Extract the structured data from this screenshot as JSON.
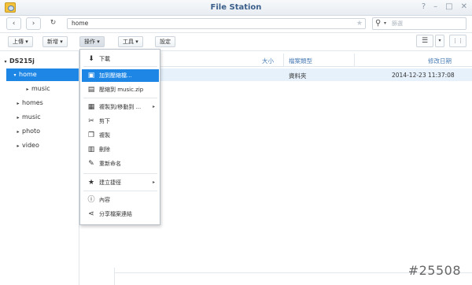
{
  "window": {
    "title": "File Station",
    "controls": [
      "?",
      "–",
      "□",
      "✕"
    ]
  },
  "navigation": {
    "back": "‹",
    "forward": "›",
    "refresh": "↻",
    "path": "home",
    "star": "★",
    "search_placeholder": "篩選"
  },
  "toolbar": {
    "upload": "上傳 ▾",
    "create": "新增 ▾",
    "action": "操作 ▾",
    "tools": "工具 ▾",
    "settings": "設定",
    "view_list": "☰",
    "view_caret": "▾",
    "view_cols": "⋮⋮"
  },
  "tree": {
    "root": "DS215j",
    "items": [
      {
        "label": "home",
        "expanded": true,
        "selected": true
      },
      {
        "label": "music",
        "child": true
      },
      {
        "label": "homes"
      },
      {
        "label": "music"
      },
      {
        "label": "photo"
      },
      {
        "label": "video"
      }
    ]
  },
  "file_list": {
    "columns": {
      "size": "大小",
      "type": "檔案類型",
      "modified": "修改日期"
    },
    "rows": [
      {
        "type": "資料夾",
        "modified": "2014-12-23 11:37:08"
      }
    ]
  },
  "context_menu": {
    "items": [
      {
        "label": "下載",
        "icon": "download-icon",
        "glyph": "⬇"
      },
      {
        "label": "加到壓縮檔...",
        "icon": "archive-icon",
        "glyph": "▣",
        "highlighted": true
      },
      {
        "label": "壓縮到 music.zip",
        "icon": "zip-icon",
        "glyph": "▤"
      },
      {
        "label": "複製到/移動到 ...",
        "icon": "copy-move-icon",
        "glyph": "▦",
        "submenu": "▸"
      },
      {
        "label": "剪下",
        "icon": "scissors-icon",
        "glyph": "✂"
      },
      {
        "label": "複製",
        "icon": "copy-icon",
        "glyph": "❐"
      },
      {
        "label": "刪除",
        "icon": "trash-icon",
        "glyph": "▥"
      },
      {
        "label": "重新命名",
        "icon": "pencil-icon",
        "glyph": "✎"
      },
      {
        "label": "建立捷徑",
        "icon": "star-icon",
        "glyph": "★",
        "submenu": "▸"
      },
      {
        "label": "內容",
        "icon": "info-icon",
        "glyph": "ⓘ"
      },
      {
        "label": "分享檔案連結",
        "icon": "share-icon",
        "glyph": "⋖"
      }
    ]
  },
  "watermark": "#25508",
  "colors": {
    "accent": "#1e87e6",
    "title": "#3a5f8a",
    "header": "#4a7cb5"
  }
}
